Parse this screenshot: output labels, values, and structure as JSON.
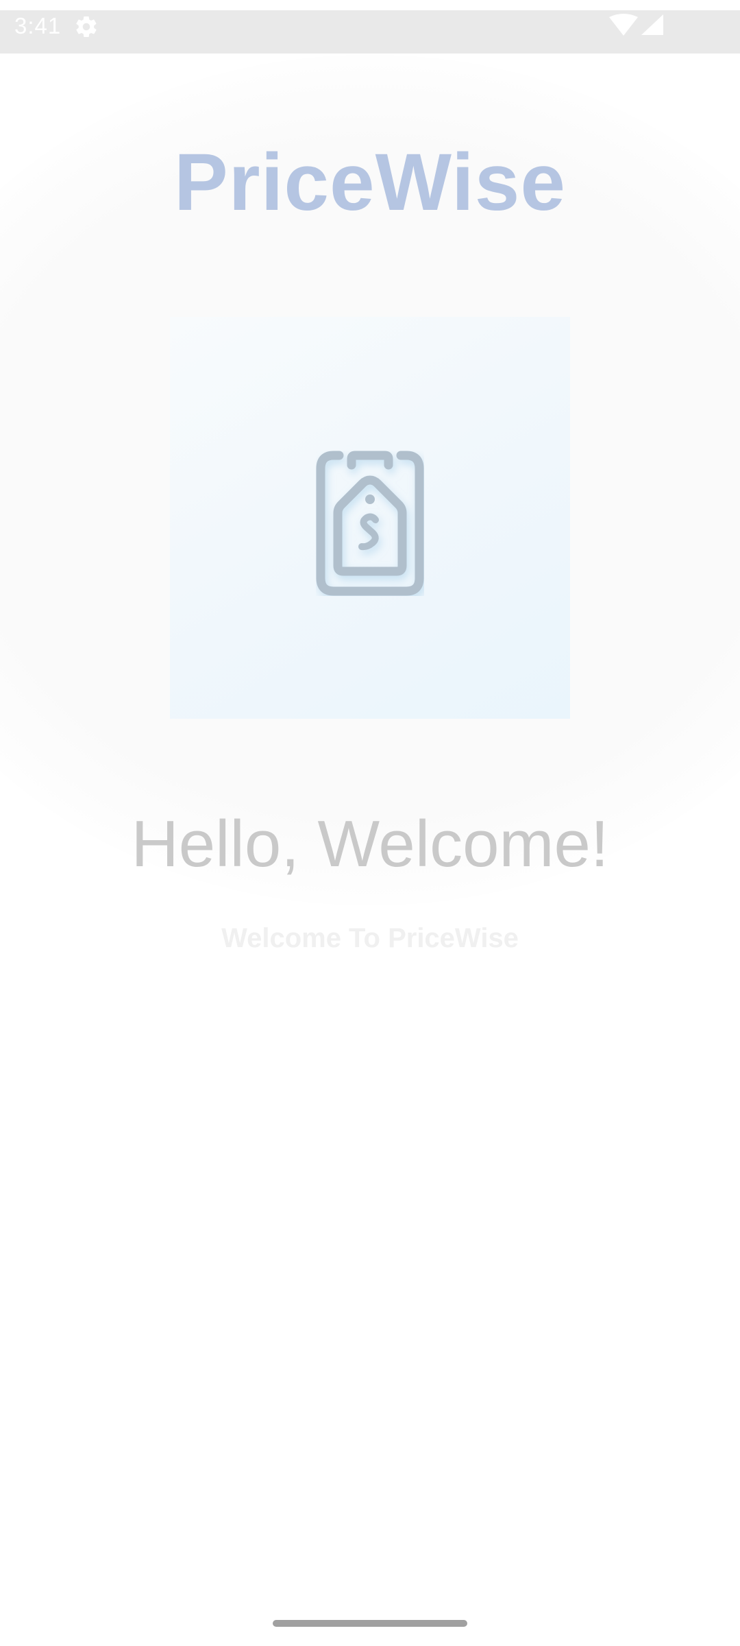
{
  "status_bar": {
    "time": "3:41",
    "icons": [
      "gear-icon",
      "wifi-icon",
      "signal-icon"
    ],
    "background": "#e9e9e9"
  },
  "app": {
    "title": "PriceWise",
    "title_color": "#b5c5e2",
    "hero_icon": "price-tag-icon",
    "icon_color": "#b0bfcc"
  },
  "welcome": {
    "heading": "Hello, Welcome!",
    "subtitle": "Welcome To PriceWise"
  },
  "navigation": {
    "home_indicator": "home-indicator"
  }
}
